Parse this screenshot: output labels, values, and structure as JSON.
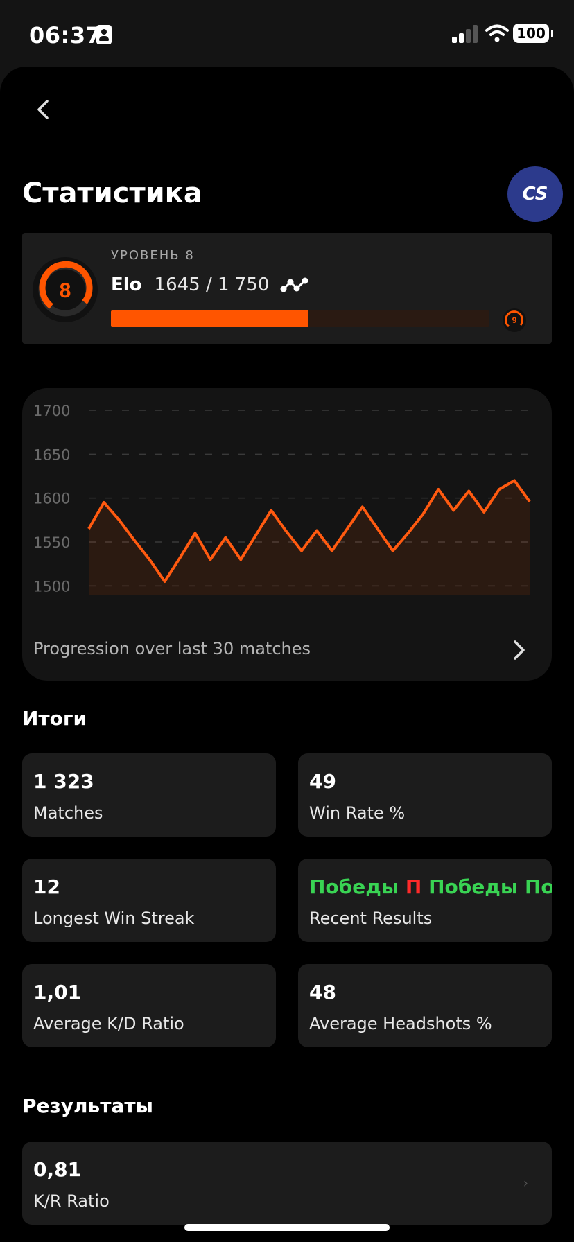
{
  "status_bar": {
    "time": "06:37",
    "battery": "100"
  },
  "page": {
    "title": "Статистика"
  },
  "game_badge": {
    "text": "CS"
  },
  "level": {
    "caption": "УРОВЕНЬ 8",
    "number": "8",
    "next_number": "9",
    "elo_label": "Elo",
    "elo_value": "1645 / 1 750",
    "progress_fraction": 0.52,
    "accent_color": "#ff5500"
  },
  "chart_data": {
    "type": "area",
    "y_ticks": [
      "1700",
      "1650",
      "1600",
      "1550",
      "1500"
    ],
    "ylim": [
      1490,
      1700
    ],
    "x": [
      1,
      2,
      3,
      4,
      5,
      6,
      7,
      8,
      9,
      10,
      11,
      12,
      13,
      14,
      15,
      16,
      17,
      18,
      19,
      20,
      21,
      22,
      23,
      24,
      25,
      26,
      27,
      28,
      29,
      30
    ],
    "values": [
      1565,
      1595,
      1575,
      1552,
      1530,
      1505,
      1532,
      1560,
      1530,
      1555,
      1530,
      1558,
      1586,
      1562,
      1540,
      1563,
      1540,
      1565,
      1590,
      1565,
      1540,
      1560,
      1582,
      1610,
      1586,
      1608,
      1584,
      1610,
      1620,
      1596
    ],
    "grid": true,
    "line_color": "#ff5a10",
    "caption": "Progression over last 30 matches"
  },
  "summary": {
    "title": "Итоги",
    "cards": [
      {
        "value": "1 323",
        "label": "Matches"
      },
      {
        "value": "49",
        "label": "Win Rate %"
      },
      {
        "value": "12",
        "label": "Longest Win Streak"
      },
      {
        "label": "Recent Results"
      },
      {
        "value": "1,01",
        "label": "Average K/D Ratio"
      },
      {
        "value": "48",
        "label": "Average Headshots %"
      }
    ],
    "recent_results": [
      {
        "text": "Победы",
        "type": "win"
      },
      {
        "text": "П",
        "type": "loss"
      },
      {
        "text": "Победы",
        "type": "win"
      },
      {
        "text": "Поб",
        "type": "win"
      }
    ]
  },
  "results": {
    "title": "Результаты",
    "cards": [
      {
        "value": "0,81",
        "label": "K/R Ratio"
      }
    ]
  }
}
